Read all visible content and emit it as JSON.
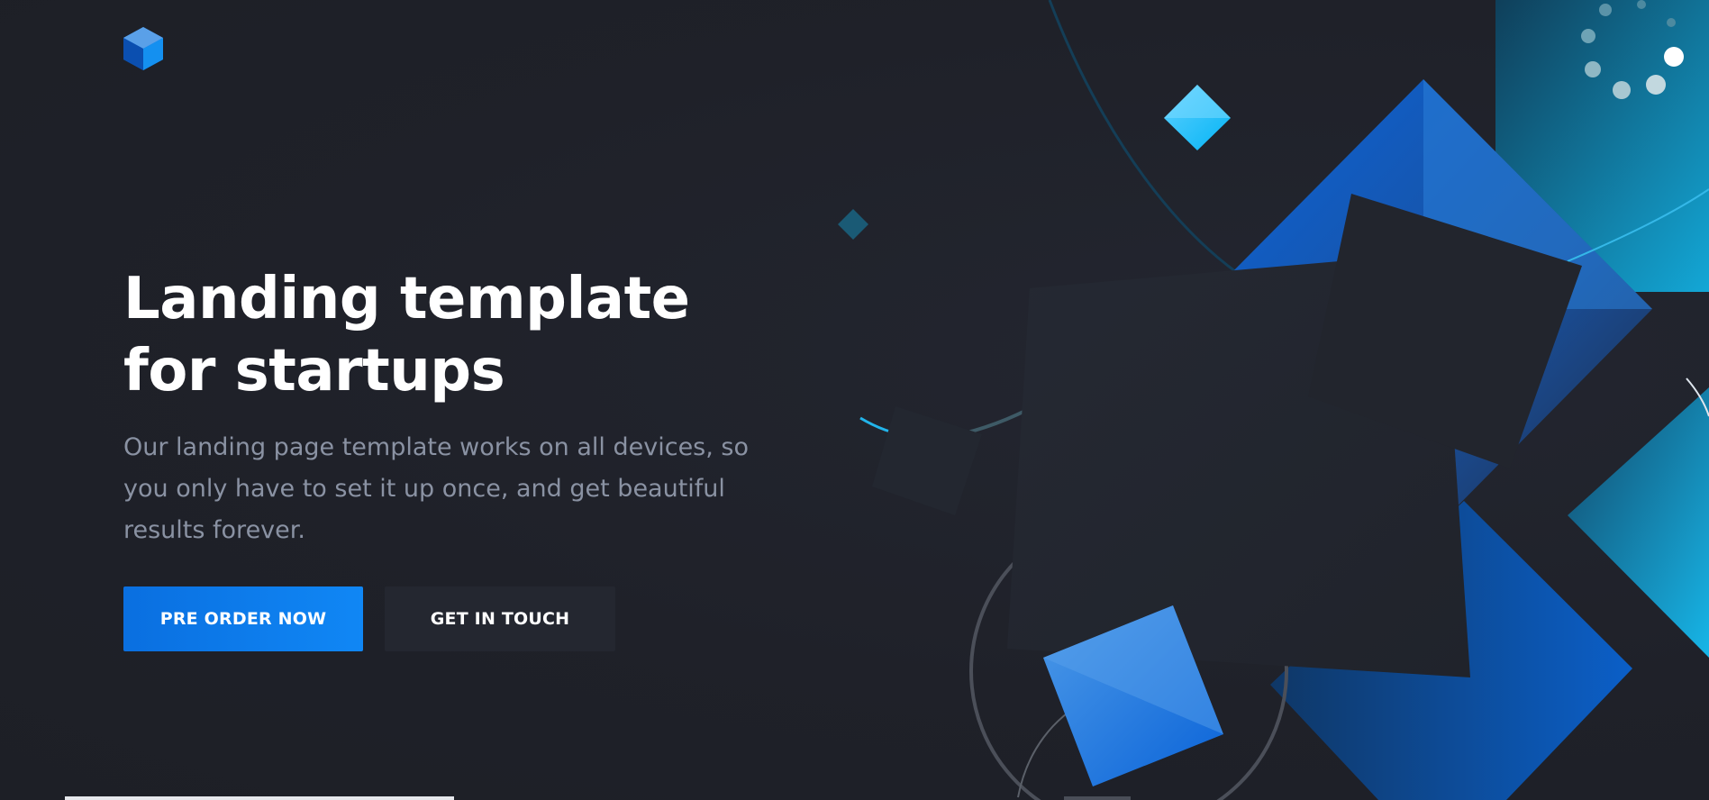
{
  "header": {
    "logo_icon": "hexagon-cube-icon"
  },
  "hero": {
    "title": "Landing template for startups",
    "paragraph": "Our landing page template works on all devices, so you only have to set it up once, and get beautiful results forever."
  },
  "cta": {
    "primary_label": "PRE ORDER NOW",
    "secondary_label": "GET IN TOUCH"
  },
  "colors": {
    "background": "#1f2129",
    "accent_blue": "#0a6fe0",
    "accent_cyan": "#14b8e6",
    "text_primary": "#ffffff",
    "text_muted": "#8a92a3"
  }
}
